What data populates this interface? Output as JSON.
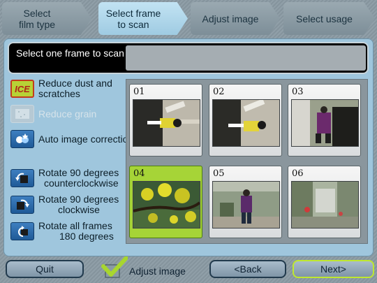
{
  "steps": [
    {
      "line1": "Select",
      "line2": "film type"
    },
    {
      "line1": "Select frame",
      "line2": "to scan"
    },
    {
      "line1": "Adjust image",
      "line2": ""
    },
    {
      "line1": "Select usage",
      "line2": ""
    }
  ],
  "active_step": 1,
  "instruction": "Select one frame to scan",
  "tools": {
    "ice": {
      "icon": "ice-icon",
      "icon_text": "ICE",
      "label1": "Reduce dust and",
      "label2": "scratches"
    },
    "grain": {
      "icon": "grain-icon",
      "label": "Reduce grain",
      "enabled": false
    },
    "auto": {
      "icon": "auto-correction-icon",
      "label": "Auto image correction"
    },
    "rotate_ccw": {
      "icon": "rotate-ccw-icon",
      "label1": "Rotate 90 degrees",
      "label2": "counterclockwise"
    },
    "rotate_cw": {
      "icon": "rotate-cw-icon",
      "label1": "Rotate 90 degrees",
      "label2": "clockwise"
    },
    "rotate_180": {
      "icon": "rotate-180-icon",
      "label1": "Rotate all frames",
      "label2": "180 degrees"
    }
  },
  "frames": [
    {
      "number": "01",
      "selected": false,
      "scene": "rotated-walker"
    },
    {
      "number": "02",
      "selected": false,
      "scene": "rotated-walker"
    },
    {
      "number": "03",
      "selected": false,
      "scene": "rotated-person"
    },
    {
      "number": "04",
      "selected": true,
      "scene": "tree-flowers"
    },
    {
      "number": "05",
      "selected": false,
      "scene": "person-standing"
    },
    {
      "number": "06",
      "selected": false,
      "scene": "garden"
    }
  ],
  "bottom": {
    "quit": "Quit",
    "adjust_image": "Adjust image",
    "adjust_checked": true,
    "back": "<Back",
    "next": "Next>"
  },
  "colors": {
    "accent_green": "#bfe82f",
    "active_step": "#b3dbef",
    "panel": "#9fc6dd"
  }
}
